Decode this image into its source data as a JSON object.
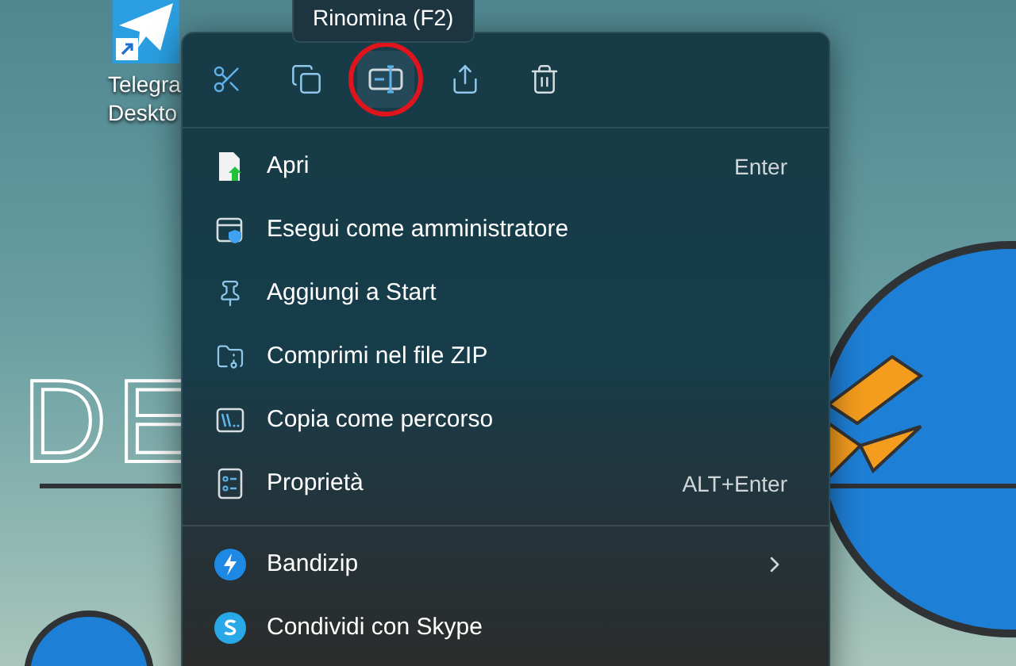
{
  "desktop": {
    "wallpaper_text": "DE",
    "icons": [
      {
        "kind": "telegram",
        "label_lines": [
          "Telegra",
          "Deskto"
        ],
        "shortcut": true
      }
    ]
  },
  "tooltip": "Rinomina (F2)",
  "context_menu": {
    "toolbar": [
      {
        "kind": "cut",
        "selected": false,
        "circled": false
      },
      {
        "kind": "copy",
        "selected": false,
        "circled": false
      },
      {
        "kind": "rename",
        "selected": true,
        "circled": true
      },
      {
        "kind": "share",
        "selected": false,
        "circled": false
      },
      {
        "kind": "delete",
        "selected": false,
        "circled": false
      }
    ],
    "sections": [
      [
        {
          "kind": "open",
          "label": "Apri",
          "shortcut": "Enter"
        },
        {
          "kind": "admin",
          "label": "Esegui come amministratore"
        },
        {
          "kind": "pin",
          "label": "Aggiungi a Start"
        },
        {
          "kind": "zip",
          "label": "Comprimi nel file ZIP"
        },
        {
          "kind": "copy-path",
          "label": "Copia come percorso"
        },
        {
          "kind": "properties",
          "label": "Proprietà",
          "shortcut": "ALT+Enter"
        }
      ],
      [
        {
          "kind": "bandizip",
          "label": "Bandizip",
          "submenu": true
        },
        {
          "kind": "skype",
          "label": "Condividi con Skype"
        }
      ]
    ]
  }
}
